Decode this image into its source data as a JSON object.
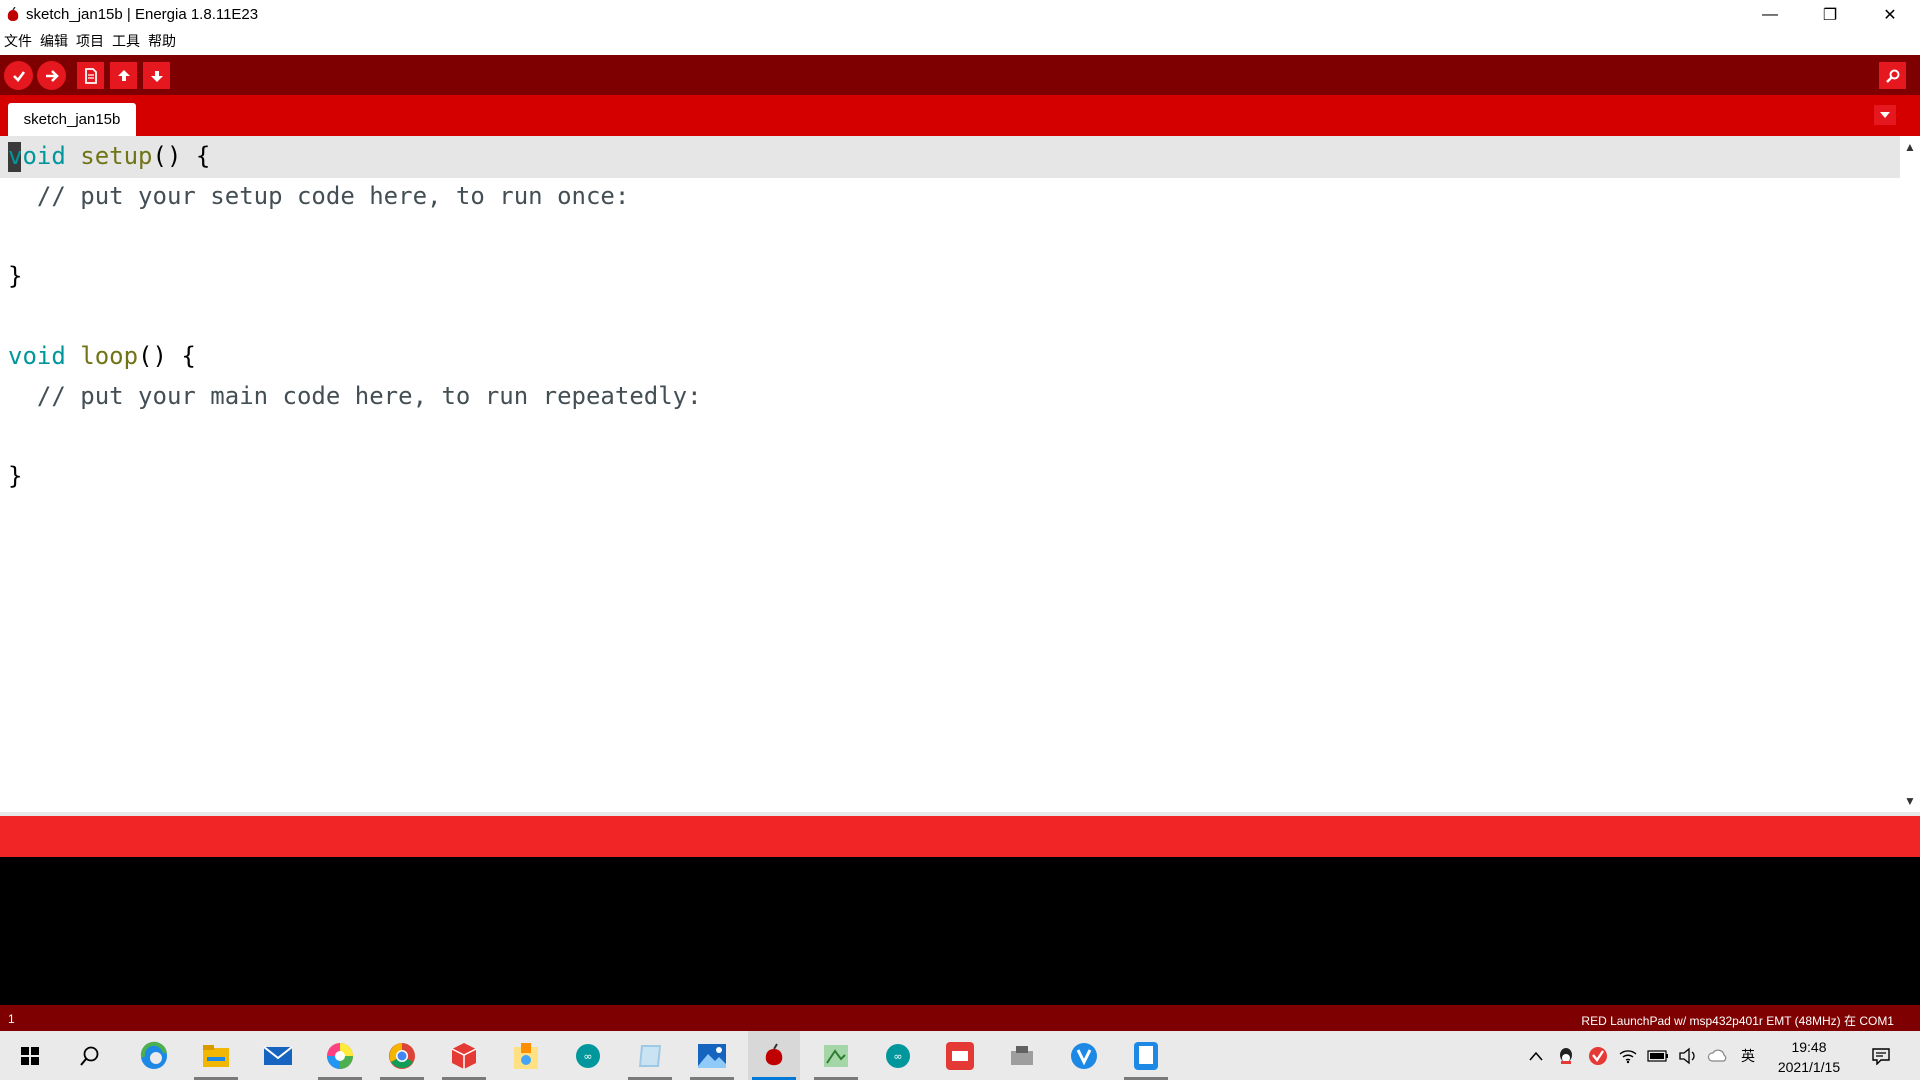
{
  "window": {
    "title": "sketch_jan15b | Energia 1.8.11E23",
    "minimize_glyph": "—",
    "restore_glyph": "❐",
    "close_glyph": "✕"
  },
  "menu": [
    "文件",
    "编辑",
    "项目",
    "工具",
    "帮助"
  ],
  "toolbar": {
    "buttons": [
      "verify-icon",
      "upload-icon",
      "new-icon",
      "open-icon",
      "save-icon"
    ],
    "serial_monitor": "serial-monitor-icon"
  },
  "tabs": [
    {
      "label": "sketch_jan15b",
      "active": true
    }
  ],
  "editor": {
    "lines": [
      {
        "tokens": [
          {
            "t": "void",
            "c": "kw"
          },
          {
            "t": " "
          },
          {
            "t": "setup",
            "c": "fn"
          },
          {
            "t": "() {"
          }
        ]
      },
      {
        "tokens": [
          {
            "t": "  // put your setup code here, to run once:",
            "c": "cm"
          }
        ]
      },
      {
        "tokens": [
          {
            "t": ""
          }
        ]
      },
      {
        "tokens": [
          {
            "t": "}"
          }
        ]
      },
      {
        "tokens": [
          {
            "t": ""
          }
        ]
      },
      {
        "tokens": [
          {
            "t": "void",
            "c": "kw"
          },
          {
            "t": " "
          },
          {
            "t": "loop",
            "c": "fn"
          },
          {
            "t": "() {"
          }
        ]
      },
      {
        "tokens": [
          {
            "t": "  // put your main code here, to run repeatedly:",
            "c": "cm"
          }
        ]
      },
      {
        "tokens": [
          {
            "t": ""
          }
        ]
      },
      {
        "tokens": [
          {
            "t": "}"
          }
        ]
      }
    ]
  },
  "statusbar": {
    "line_number": "1",
    "board": "RED LaunchPad w/ msp432p401r EMT (48MHz) 在 COM1"
  },
  "taskbar": {
    "apps": [
      "start-icon",
      "search-icon",
      "edge-icon",
      "file-explorer-icon",
      "mail-icon",
      "color-app-icon",
      "chrome-icon",
      "cube-app-icon",
      "package-app-icon",
      "arduino-icon",
      "notes-icon",
      "photos-icon",
      "energia-icon",
      "sketch-app-icon",
      "arduino-icon",
      "youdao-icon",
      "device-app-icon",
      "v-app-icon",
      "tablet-app-icon"
    ],
    "tray": {
      "ime": "英",
      "time": "19:48",
      "date": "2021/1/15"
    }
  },
  "colors": {
    "toolbar": "#7f0000",
    "tabbar": "#d40000",
    "status": "#f12525",
    "button": "#e4181e",
    "keyword": "#00979c",
    "function": "#727418",
    "comment": "#434f54"
  }
}
